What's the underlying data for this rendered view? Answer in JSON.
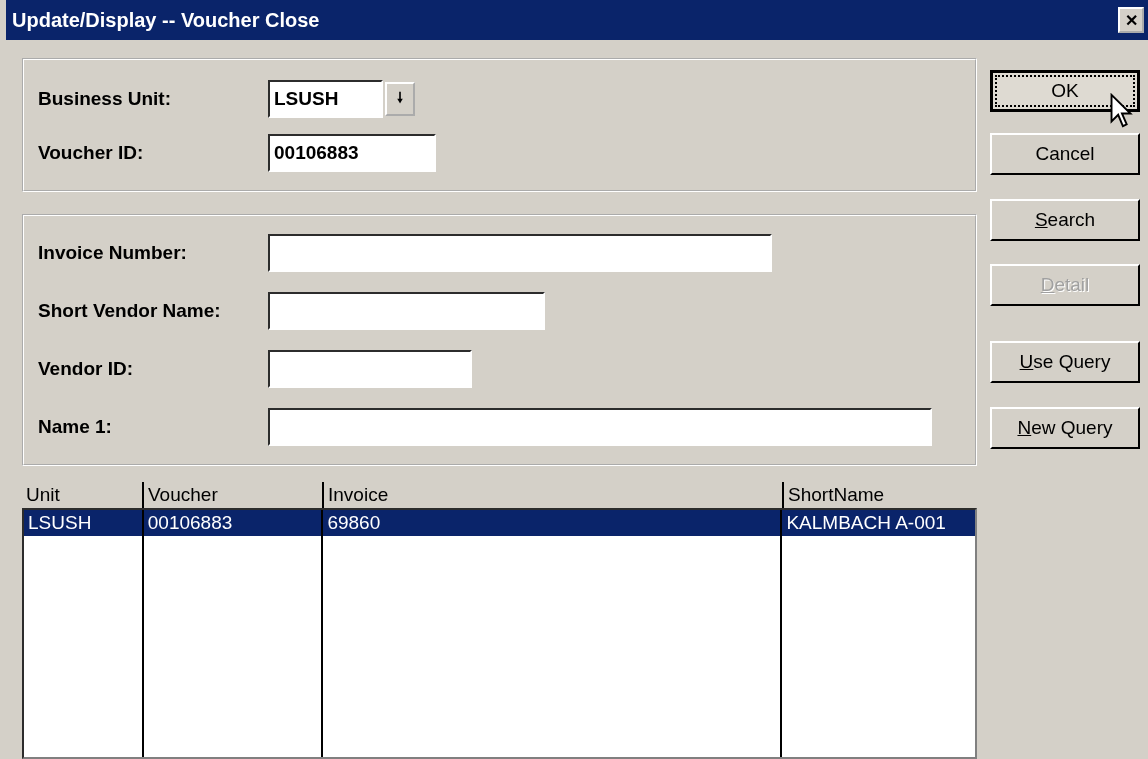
{
  "window": {
    "title": "Update/Display -- Voucher Close",
    "close_glyph": "✕"
  },
  "key_fields": [
    {
      "label": "Business Unit:",
      "value": "LSUSH",
      "kind": "dropdown",
      "dropdown_glyph": "🠗"
    },
    {
      "label": "Voucher ID:",
      "value": "00106883",
      "kind": "text"
    }
  ],
  "search_fields": [
    {
      "label": "Invoice Number:",
      "kind": "wide"
    },
    {
      "label": "Short Vendor Name:",
      "kind": "medium"
    },
    {
      "label": "Vendor ID:",
      "kind": "short"
    },
    {
      "label": "Name 1:",
      "kind": "full"
    }
  ],
  "buttons": [
    {
      "label": "OK",
      "focused": true,
      "disabled": false,
      "underline_first": false
    },
    {
      "label": "Cancel",
      "focused": false,
      "disabled": false,
      "underline_first": false
    },
    {
      "label": "Search",
      "focused": false,
      "disabled": false,
      "underline_first": true
    },
    {
      "label": "Detail",
      "focused": false,
      "disabled": true,
      "underline_first": true
    },
    {
      "label": "Use Query",
      "focused": false,
      "disabled": false,
      "underline_first": true
    },
    {
      "label": "New Query",
      "focused": false,
      "disabled": false,
      "underline_first": true
    }
  ],
  "table": {
    "columns": [
      "Unit",
      "Voucher",
      "Invoice",
      "ShortName"
    ],
    "rows": [
      {
        "cells": [
          "LSUSH",
          "00106883",
          "69860",
          "KALMBACH A-001"
        ],
        "selected": true
      }
    ]
  }
}
